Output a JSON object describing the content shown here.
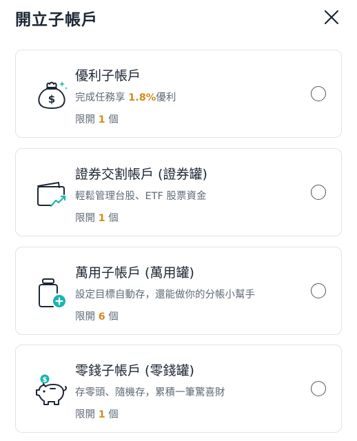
{
  "header": {
    "title": "開立子帳戶",
    "close_icon": "close-icon"
  },
  "accent_color": "#d48b1e",
  "icon_accent_color": "#1ab3b3",
  "options": [
    {
      "name": "優利子帳戶",
      "desc_prefix": "完成任務享 ",
      "desc_highlight": "1.8%",
      "desc_suffix": "優利",
      "limit_prefix": "限開 ",
      "limit_count": "1",
      "limit_suffix": " 個",
      "icon": "money-bag-icon"
    },
    {
      "name": "證券交割帳戶 (證券罐)",
      "description": "輕鬆管理台股、ETF 股票資金",
      "limit_prefix": "限開 ",
      "limit_count": "1",
      "limit_suffix": " 個",
      "icon": "wallet-chart-icon"
    },
    {
      "name": "萬用子帳戶 (萬用罐)",
      "description": "設定目標自動存，還能做你的分帳小幫手",
      "limit_prefix": "限開 ",
      "limit_count": "6",
      "limit_suffix": " 個",
      "icon": "jar-add-icon"
    },
    {
      "name": "零錢子帳戶 (零錢罐)",
      "description": "存零頭、隨機存，累積一筆驚喜財",
      "limit_prefix": "限開 ",
      "limit_count": "1",
      "limit_suffix": " 個",
      "icon": "piggy-bank-icon"
    }
  ]
}
